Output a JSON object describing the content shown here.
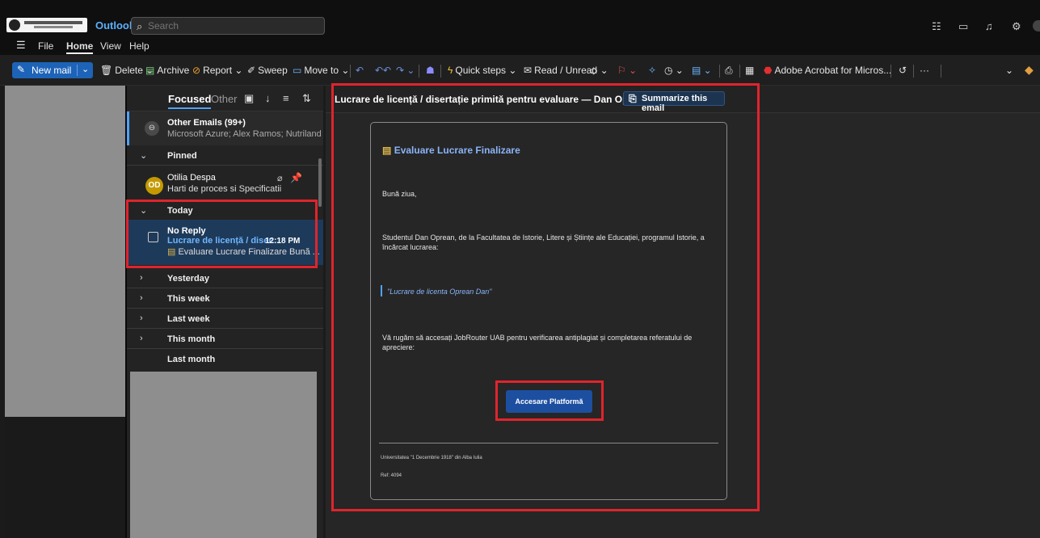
{
  "titlebar": {
    "app_name": "Outlook",
    "search_placeholder": "Search",
    "icons": [
      "teams-icon",
      "chat-icon",
      "bell-icon",
      "settings-icon"
    ]
  },
  "menu": {
    "items": [
      "File",
      "Home",
      "View",
      "Help"
    ],
    "active": "Home"
  },
  "ribbon": {
    "new_mail": "New mail",
    "delete": "Delete",
    "archive": "Archive",
    "report": "Report",
    "sweep": "Sweep",
    "move_to": "Move to",
    "quick_steps": "Quick steps",
    "read_unread": "Read / Unread",
    "acrobat": "Adobe Acrobat for Micros...",
    "more": "···"
  },
  "mail_list": {
    "tabs": {
      "focused": "Focused",
      "other": "Other"
    },
    "other_emails": {
      "title": "Other Emails (99+)",
      "senders": "Microsoft Azure; Alex Ramos; Nutriland™;..."
    },
    "groups": {
      "pinned": "Pinned",
      "today": "Today",
      "yesterday": "Yesterday",
      "this_week": "This week",
      "last_week": "Last week",
      "this_month": "This month",
      "last_month": "Last month"
    },
    "pinned_item": {
      "initials": "OD",
      "sender": "Otilia Despa",
      "subject": "Harti de proces si Specificatii"
    },
    "selected_item": {
      "sender": "No Reply",
      "subject": "Lucrare de licență / diser...",
      "time": "12:18 PM",
      "preview": "Evaluare Lucrare Finalizare Bună ..."
    }
  },
  "reading": {
    "subject": "Lucrare de licență / disertație primită pentru evaluare — Dan Oprean",
    "summarize": "Summarize this email",
    "card": {
      "title": "Evaluare Lucrare Finalizare",
      "greeting": "Bună ziua,",
      "body1": "Studentul Dan Oprean, de la Facultatea de Istorie, Litere și Științe ale Educației, programul Istorie, a încărcat lucrarea:",
      "quote": "\"Lucrare de licenta Oprean Dan\"",
      "body2": "Vă rugăm să accesați JobRouter UAB pentru verificarea antiplagiat și completarea referatului de apreciere:",
      "cta": "Accesare Platformă",
      "footer_org": "Universitatea \"1 Decembrie 1918\" din Alba Iulia",
      "footer_ref": "Ref: 4094"
    }
  },
  "colors": {
    "accent": "#4fa3ff",
    "new_mail_bg": "#1d63b8",
    "selected_bg": "#1e3a5a",
    "highlight_box": "#e0242c",
    "cta_bg": "#1d4fa0"
  }
}
